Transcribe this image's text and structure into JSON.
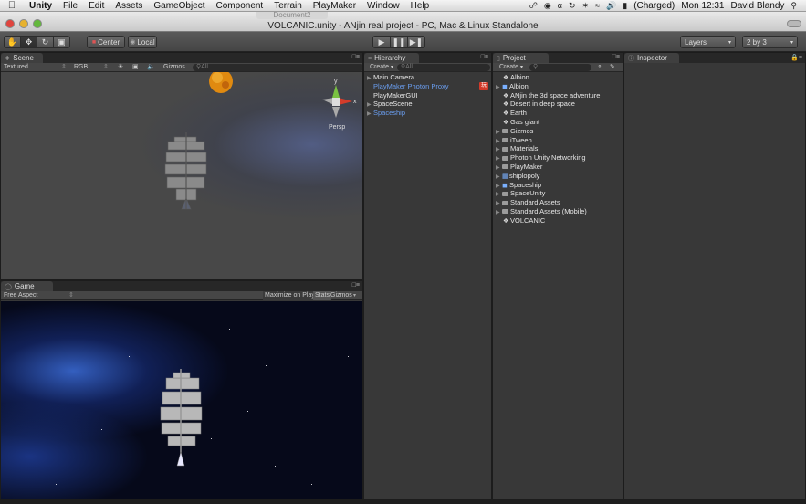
{
  "menubar": {
    "apple_icon": "apple-icon",
    "items": [
      "Unity",
      "File",
      "Edit",
      "Assets",
      "GameObject",
      "Component",
      "Terrain",
      "PlayMaker",
      "Window",
      "Help"
    ],
    "battery": "(Charged)",
    "clock": "Mon 12:31",
    "user": "David Blandy"
  },
  "window": {
    "title": "VOLCANIC.unity - ANjin real project - PC, Mac & Linux Standalone",
    "background_tab": "Document2"
  },
  "toolbar": {
    "pivot": "Center",
    "space": "Local",
    "layers": "Layers",
    "layout": "2 by 3"
  },
  "scene": {
    "tab": "Scene",
    "render_mode": "Textured",
    "color_mode": "RGB",
    "gizmos": "Gizmos",
    "search_placeholder": "All",
    "persp_label": "Persp"
  },
  "game": {
    "tab": "Game",
    "aspect": "Free Aspect",
    "maximize": "Maximize on Play",
    "stats": "Stats",
    "gizmos": "Gizmos"
  },
  "hierarchy": {
    "tab": "Hierarchy",
    "create": "Create",
    "search_placeholder": "All",
    "items": [
      {
        "label": "Main Camera",
        "prefab": false,
        "expandable": true
      },
      {
        "label": "PlayMaker Photon Proxy",
        "prefab": true,
        "expandable": false,
        "badge": true
      },
      {
        "label": "PlayMakerGUI",
        "prefab": false,
        "expandable": false
      },
      {
        "label": "SpaceScene",
        "prefab": false,
        "expandable": true
      },
      {
        "label": "Spaceship",
        "prefab": true,
        "expandable": true
      }
    ]
  },
  "project": {
    "tab": "Project",
    "create": "Create",
    "items": [
      {
        "label": "Albion",
        "kind": "scene",
        "expandable": false
      },
      {
        "label": "Albion",
        "kind": "prefab",
        "expandable": true
      },
      {
        "label": "ANjin the 3d space adventure",
        "kind": "scene",
        "expandable": false
      },
      {
        "label": "Desert in deep space",
        "kind": "scene",
        "expandable": false
      },
      {
        "label": "Earth",
        "kind": "scene",
        "expandable": false
      },
      {
        "label": "Gas giant",
        "kind": "scene",
        "expandable": false
      },
      {
        "label": "Gizmos",
        "kind": "folder",
        "expandable": true
      },
      {
        "label": "iTween",
        "kind": "folder",
        "expandable": true
      },
      {
        "label": "Materials",
        "kind": "folder",
        "expandable": true
      },
      {
        "label": "Photon Unity Networking",
        "kind": "folder",
        "expandable": true
      },
      {
        "label": "PlayMaker",
        "kind": "folder",
        "expandable": true
      },
      {
        "label": "shiplopoly",
        "kind": "model",
        "expandable": true
      },
      {
        "label": "Spaceship",
        "kind": "prefab",
        "expandable": true
      },
      {
        "label": "SpaceUnity",
        "kind": "folder",
        "expandable": true
      },
      {
        "label": "Standard Assets",
        "kind": "folder",
        "expandable": true
      },
      {
        "label": "Standard Assets (Mobile)",
        "kind": "folder",
        "expandable": true
      },
      {
        "label": "VOLCANIC",
        "kind": "scene",
        "expandable": false
      }
    ]
  },
  "inspector": {
    "tab": "Inspector"
  },
  "colors": {
    "prefab_blue": "#6a9ef0",
    "panel_bg": "#383838",
    "badge_red": "#d23a2a"
  }
}
